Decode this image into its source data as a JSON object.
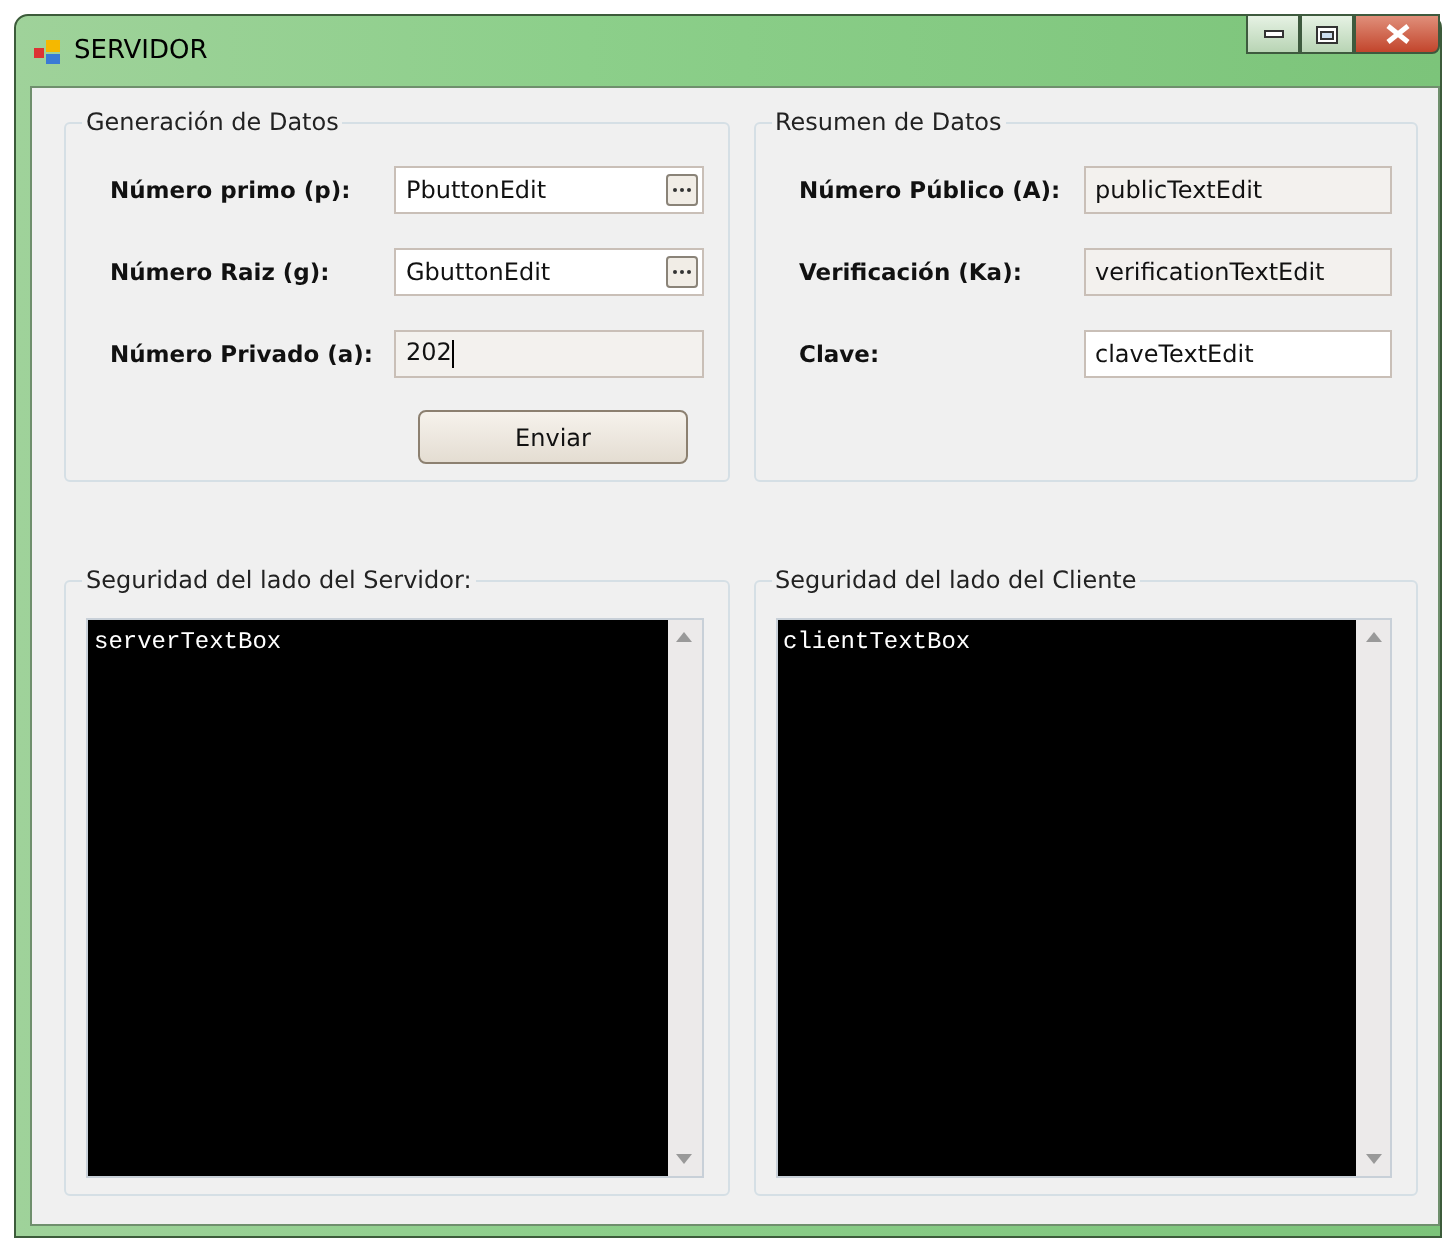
{
  "window": {
    "title": "SERVIDOR"
  },
  "generation": {
    "title": "Generación de Datos",
    "fields": [
      {
        "label": "Número primo (p):",
        "value": "PbuttonEdit",
        "kind": "button_edit",
        "read_only": false,
        "focused": false
      },
      {
        "label": "Número Raiz (g):",
        "value": "GbuttonEdit",
        "kind": "button_edit",
        "read_only": false,
        "focused": false
      },
      {
        "label": "Número Privado (a):",
        "value": "202",
        "kind": "text",
        "read_only": true,
        "focused": true
      }
    ],
    "button": "Enviar"
  },
  "summary": {
    "title": "Resumen de Datos",
    "fields": [
      {
        "label": "Número Público (A):",
        "value": "publicTextEdit",
        "kind": "text",
        "read_only": true,
        "focused": false
      },
      {
        "label": "Verificación (Ka):",
        "value": "verificationTextEdit",
        "kind": "text",
        "read_only": true,
        "focused": false
      },
      {
        "label": "Clave:",
        "value": "claveTextEdit",
        "kind": "text",
        "read_only": false,
        "focused": false
      }
    ]
  },
  "consoles": [
    {
      "title": "Seguridad del lado del Servidor:",
      "text": "serverTextBox"
    },
    {
      "title": "Seguridad del lado del Cliente",
      "text": "clientTextBox"
    }
  ]
}
